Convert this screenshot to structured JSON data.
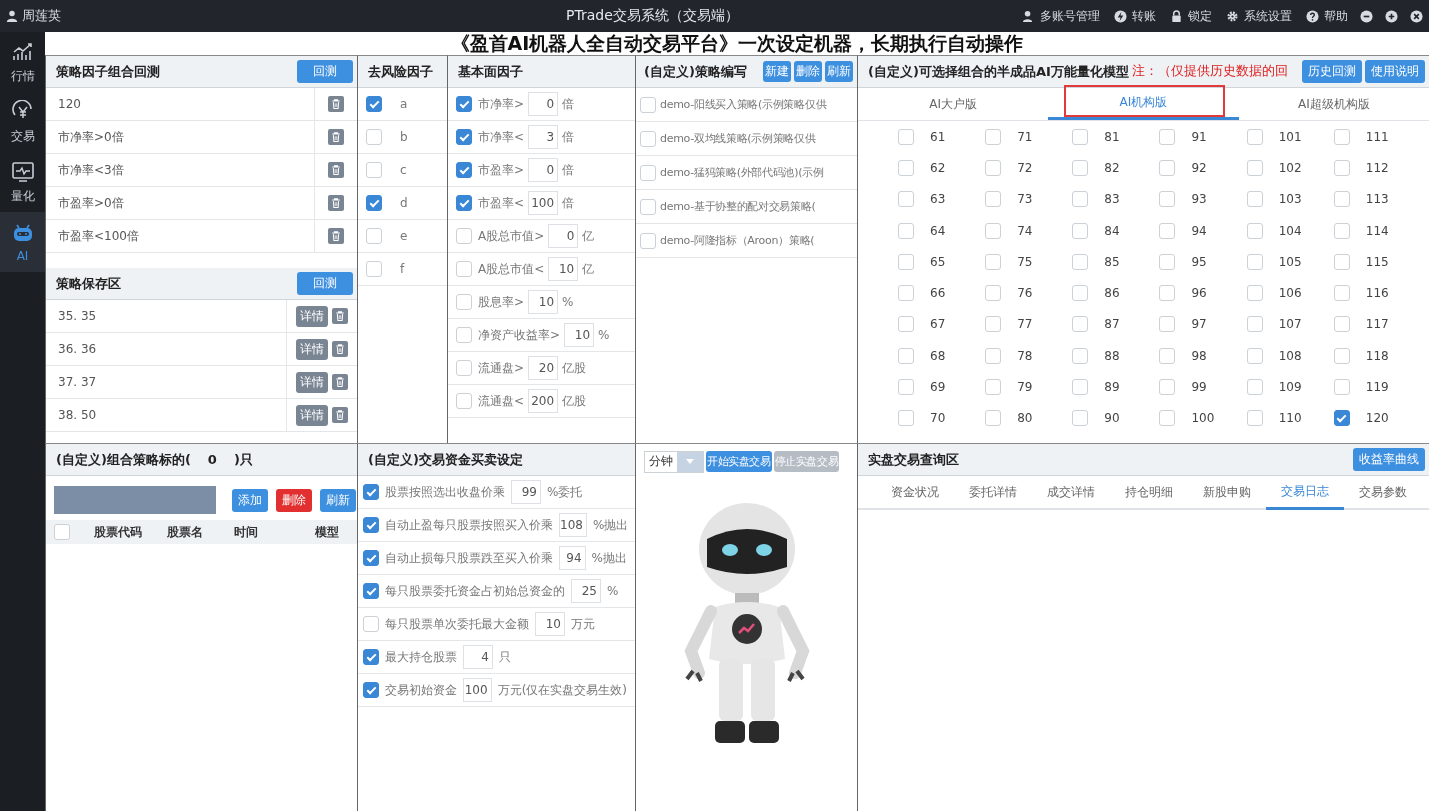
{
  "title_bar": {
    "user": "周莲英",
    "title": "PTrade交易系统（交易端）",
    "menu": [
      {
        "label": "多账号管理",
        "kind": "accounts"
      },
      {
        "label": "转账",
        "kind": "transfer"
      },
      {
        "label": "锁定",
        "kind": "lock"
      },
      {
        "label": "系统设置",
        "kind": "settings"
      },
      {
        "label": "帮助",
        "kind": "help"
      }
    ]
  },
  "sidebar": {
    "items": [
      {
        "label": "行情",
        "kind": "chart",
        "selected": false
      },
      {
        "label": "交易",
        "kind": "yen",
        "selected": false
      },
      {
        "label": "量化",
        "kind": "monitor",
        "selected": false
      },
      {
        "label": "AI",
        "kind": "robot",
        "selected": true
      }
    ]
  },
  "banner": "《盈首AI机器人全自动交易平台》一次设定机器，长期执行自动操作",
  "backtest_panel": {
    "title": "策略因子组合回测",
    "button": "回测",
    "rows": [
      "120",
      "市净率>0倍",
      "市净率<3倍",
      "市盈率>0倍",
      "市盈率<100倍"
    ]
  },
  "save_panel": {
    "title": "策略保存区",
    "button": "回测",
    "rows": [
      {
        "text": "35.  35",
        "button": "详情"
      },
      {
        "text": "36.  36",
        "button": "详情"
      },
      {
        "text": "37.  37",
        "button": "详情"
      },
      {
        "text": "38.  50",
        "button": "详情"
      }
    ]
  },
  "risk_panel": {
    "title": "去风险因子",
    "items": [
      {
        "label": "a",
        "checked": true
      },
      {
        "label": "b",
        "checked": false
      },
      {
        "label": "c",
        "checked": false
      },
      {
        "label": "d",
        "checked": true
      },
      {
        "label": "e",
        "checked": false
      },
      {
        "label": "f",
        "checked": false
      }
    ]
  },
  "fundamental_panel": {
    "title": "基本面因子",
    "items": [
      {
        "label": "市净率>",
        "value": "0",
        "unit": "倍",
        "checked": true
      },
      {
        "label": "市净率<",
        "value": "3",
        "unit": "倍",
        "checked": true
      },
      {
        "label": "市盈率>",
        "value": "0",
        "unit": "倍",
        "checked": true
      },
      {
        "label": "市盈率<",
        "value": "100",
        "unit": "倍",
        "checked": true
      },
      {
        "label": "A股总市值>",
        "value": "0",
        "unit": "亿",
        "checked": false
      },
      {
        "label": "A股总市值<",
        "value": "10",
        "unit": "亿",
        "checked": false
      },
      {
        "label": "股息率>",
        "value": "10",
        "unit": "%",
        "checked": false
      },
      {
        "label": "净资产收益率>",
        "value": "10",
        "unit": "%",
        "checked": false
      },
      {
        "label": "流通盘>",
        "value": "20",
        "unit": "亿股",
        "checked": false
      },
      {
        "label": "流通盘<",
        "value": "200",
        "unit": "亿股",
        "checked": false
      }
    ]
  },
  "strategy_panel": {
    "title": "(自定义)策略编写",
    "buttons": [
      "新建",
      "删除",
      "刷新"
    ],
    "items": [
      {
        "label": "demo-阳线买入策略(示例策略仅供",
        "checked": false
      },
      {
        "label": "demo-双均线策略(示例策略仅供",
        "checked": false
      },
      {
        "label": "demo-猛犸策略(外部代码池)(示例",
        "checked": false
      },
      {
        "label": "demo-基于协整的配对交易策略(",
        "checked": false
      },
      {
        "label": "demo-阿隆指标（Aroon）策略(",
        "checked": false
      }
    ]
  },
  "model_panel": {
    "title": "(自定义)可选择组合的半成品AI万能量化模型",
    "note": "注：（仅提供历史数据的回",
    "buttons": [
      "历史回测",
      "使用说明"
    ],
    "tabs": [
      {
        "label": "AI大户版",
        "selected": false
      },
      {
        "label": "AI机构版",
        "selected": true
      },
      {
        "label": "AI超级机构版",
        "selected": false
      }
    ],
    "models": [
      {
        "label": "61",
        "checked": false
      },
      {
        "label": "62",
        "checked": false
      },
      {
        "label": "63",
        "checked": false
      },
      {
        "label": "64",
        "checked": false
      },
      {
        "label": "65",
        "checked": false
      },
      {
        "label": "66",
        "checked": false
      },
      {
        "label": "67",
        "checked": false
      },
      {
        "label": "68",
        "checked": false
      },
      {
        "label": "69",
        "checked": false
      },
      {
        "label": "70",
        "checked": false
      },
      {
        "label": "71",
        "checked": false
      },
      {
        "label": "72",
        "checked": false
      },
      {
        "label": "73",
        "checked": false
      },
      {
        "label": "74",
        "checked": false
      },
      {
        "label": "75",
        "checked": false
      },
      {
        "label": "76",
        "checked": false
      },
      {
        "label": "77",
        "checked": false
      },
      {
        "label": "78",
        "checked": false
      },
      {
        "label": "79",
        "checked": false
      },
      {
        "label": "80",
        "checked": false
      },
      {
        "label": "81",
        "checked": false
      },
      {
        "label": "82",
        "checked": false
      },
      {
        "label": "83",
        "checked": false
      },
      {
        "label": "84",
        "checked": false
      },
      {
        "label": "85",
        "checked": false
      },
      {
        "label": "86",
        "checked": false
      },
      {
        "label": "87",
        "checked": false
      },
      {
        "label": "88",
        "checked": false
      },
      {
        "label": "89",
        "checked": false
      },
      {
        "label": "90",
        "checked": false
      },
      {
        "label": "91",
        "checked": false
      },
      {
        "label": "92",
        "checked": false
      },
      {
        "label": "93",
        "checked": false
      },
      {
        "label": "94",
        "checked": false
      },
      {
        "label": "95",
        "checked": false
      },
      {
        "label": "96",
        "checked": false
      },
      {
        "label": "97",
        "checked": false
      },
      {
        "label": "98",
        "checked": false
      },
      {
        "label": "99",
        "checked": false
      },
      {
        "label": "100",
        "checked": false
      },
      {
        "label": "101",
        "checked": false
      },
      {
        "label": "102",
        "checked": false
      },
      {
        "label": "103",
        "checked": false
      },
      {
        "label": "104",
        "checked": false
      },
      {
        "label": "105",
        "checked": false
      },
      {
        "label": "106",
        "checked": false
      },
      {
        "label": "107",
        "checked": false
      },
      {
        "label": "108",
        "checked": false
      },
      {
        "label": "109",
        "checked": false
      },
      {
        "label": "110",
        "checked": false
      },
      {
        "label": "111",
        "checked": false
      },
      {
        "label": "112",
        "checked": false
      },
      {
        "label": "113",
        "checked": false
      },
      {
        "label": "114",
        "checked": false
      },
      {
        "label": "115",
        "checked": false
      },
      {
        "label": "116",
        "checked": false
      },
      {
        "label": "117",
        "checked": false
      },
      {
        "label": "118",
        "checked": false
      },
      {
        "label": "119",
        "checked": false
      },
      {
        "label": "120",
        "checked": true
      }
    ]
  },
  "portfolio_panel": {
    "title": "(自定义)组合策略标的(",
    "count": "0",
    "title_suffix": ")只",
    "buttons": [
      {
        "label": "添加",
        "kind": "primary"
      },
      {
        "label": "删除",
        "kind": "danger"
      },
      {
        "label": "刷新",
        "kind": "primary"
      }
    ],
    "header_checked": false,
    "columns": [
      "股票代码",
      "股票名",
      "时间",
      "模型"
    ]
  },
  "trade_settings": {
    "title": "(自定义)交易资金买卖设定",
    "items": [
      {
        "label": "股票按照选出收盘价乘",
        "value": "99",
        "unit": "%委托",
        "checked": true
      },
      {
        "label": "自动止盈每只股票按照买入价乘",
        "value": "108",
        "unit": "%抛出",
        "checked": true
      },
      {
        "label": "自动止损每只股票跌至买入价乘",
        "value": "94",
        "unit": "%抛出",
        "checked": true
      },
      {
        "label": "每只股票委托资金占初始总资金的",
        "value": "25",
        "unit": "%",
        "checked": true
      },
      {
        "label": "每只股票单次委托最大金额",
        "value": "10",
        "unit": "万元",
        "checked": false
      },
      {
        "label": "最大持仓股票",
        "value": "4",
        "unit": "只",
        "checked": true
      },
      {
        "label": "交易初始资金",
        "value": "100",
        "unit": "万元(仅在实盘交易生效)",
        "checked": true
      }
    ]
  },
  "robot_panel": {
    "interval": "分钟",
    "buttons": [
      {
        "label": "开始实盘交易",
        "disabled": false
      },
      {
        "label": "停止实盘交易",
        "disabled": true
      }
    ]
  },
  "query_panel": {
    "title": "实盘交易查询区",
    "button": "收益率曲线",
    "tabs": [
      {
        "label": "资金状况",
        "selected": false
      },
      {
        "label": "委托详情",
        "selected": false
      },
      {
        "label": "成交详情",
        "selected": false
      },
      {
        "label": "持仓明细",
        "selected": false
      },
      {
        "label": "新股申购",
        "selected": false
      },
      {
        "label": "交易日志",
        "selected": true
      },
      {
        "label": "交易参数",
        "selected": false
      }
    ]
  }
}
